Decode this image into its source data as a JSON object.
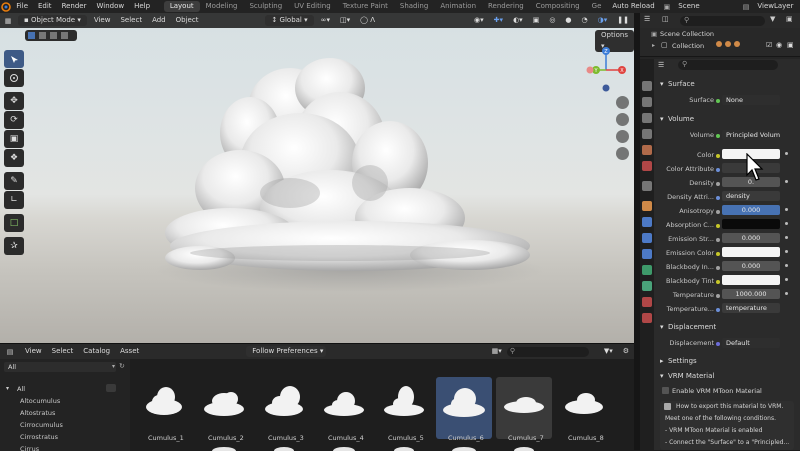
{
  "menubar": {
    "menus": [
      "File",
      "Edit",
      "Render",
      "Window",
      "Help"
    ],
    "workspaces": [
      "Layout",
      "Modeling",
      "Sculpting",
      "UV Editing",
      "Texture Paint",
      "Shading",
      "Animation",
      "Rendering",
      "Compositing",
      "Ge"
    ],
    "auto_reload": "Auto Reload",
    "scene": "Scene",
    "view_layer": "ViewLayer"
  },
  "viewport": {
    "mode": "Object Mode",
    "menus": [
      "View",
      "Select",
      "Add",
      "Object"
    ],
    "orientation": "Global",
    "options": "Options",
    "gizmo": {
      "x": "X",
      "y": "Y",
      "z": "Z"
    }
  },
  "outliner": {
    "scene_collection": "Scene Collection",
    "collection": "Collection"
  },
  "properties": {
    "surface_header": "Surface",
    "surface_label": "Surface",
    "surface_value": "None",
    "volume_header": "Volume",
    "volume_label": "Volume",
    "volume_value": "Principled Volume",
    "fields": [
      {
        "label": "Color",
        "value": "",
        "color": "#f4f4f4"
      },
      {
        "label": "Color Attribute",
        "value": "",
        "color": "#545454"
      },
      {
        "label": "Density",
        "value": "0.",
        "color": "#545454"
      },
      {
        "label": "Density Attri...",
        "value": "density",
        "color": "#3a3a3a"
      },
      {
        "label": "Anisotropy",
        "value": "0.000",
        "color": "#4772b3"
      },
      {
        "label": "Absorption C...",
        "value": "",
        "color": "#0a0a0a"
      },
      {
        "label": "Emission Str...",
        "value": "0.000",
        "color": "#545454"
      },
      {
        "label": "Emission Color",
        "value": "",
        "color": "#f4f4f4"
      },
      {
        "label": "Blackbody In...",
        "value": "0.000",
        "color": "#545454"
      },
      {
        "label": "Blackbody Tint",
        "value": "",
        "color": "#f4f4f4"
      },
      {
        "label": "Temperature",
        "value": "1000.000",
        "color": "#545454"
      },
      {
        "label": "Temperature...",
        "value": "temperature",
        "color": "#3a3a3a"
      }
    ],
    "displacement_header": "Displacement",
    "displacement_label": "Displacement",
    "displacement_value": "Default",
    "settings_header": "Settings",
    "vrm_header": "VRM Material",
    "vrm_enable": "Enable VRM MToon Material",
    "vrm_info": [
      "How to export this material to VRM.",
      "Meet one of the following conditions.",
      "- VRM MToon Material is enabled",
      "- Connect the \"Surface\" to a \"Principled..."
    ]
  },
  "asset_browser": {
    "menus": [
      "View",
      "Select",
      "Catalog",
      "Asset"
    ],
    "library": "All",
    "import": "Follow Preferences",
    "tree_root": "All",
    "categories": [
      "Altocumulus",
      "Altostratus",
      "Cirrocumulus",
      "Cirrostratus",
      "Cirrus"
    ],
    "assets": [
      "Cumulus_1",
      "Cumulus_2",
      "Cumulus_3",
      "Cumulus_4",
      "Cumulus_5",
      "Cumulus_6",
      "Cumulus_7",
      "Cumulus_8"
    ]
  },
  "colors": {
    "accent": "#4772b3",
    "selected": "#3a4f73",
    "gizmo_x": "#e0433f",
    "gizmo_y": "#7dbb2c",
    "gizmo_z": "#3d7dd8"
  }
}
